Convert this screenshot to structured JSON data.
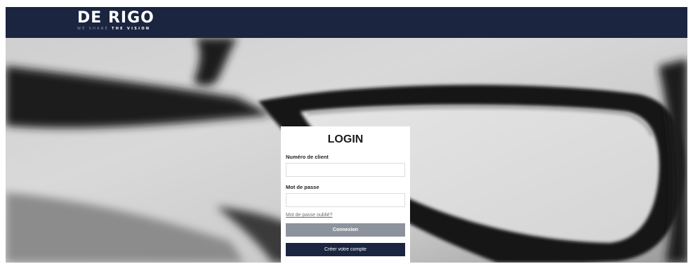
{
  "header": {
    "logo_text": "DE RIGO",
    "tagline_light": "WE SHARE",
    "tagline_bold": "THE VISION",
    "background_color": "#1b2540"
  },
  "hero": {
    "image_subject": "close-up of black eyeglasses frame, black and white photo"
  },
  "login": {
    "title": "LOGIN",
    "client_number_label": "Numéro de client",
    "client_number_value": "",
    "password_label": "Mot de passe",
    "password_value": "",
    "forgot_password_link": "Mot de passe oublié?",
    "connexion_button": "Connexion",
    "create_account_button": "Créer votre compte",
    "colors": {
      "connexion_button": "#8d939c",
      "create_account_button": "#1b2540"
    }
  }
}
